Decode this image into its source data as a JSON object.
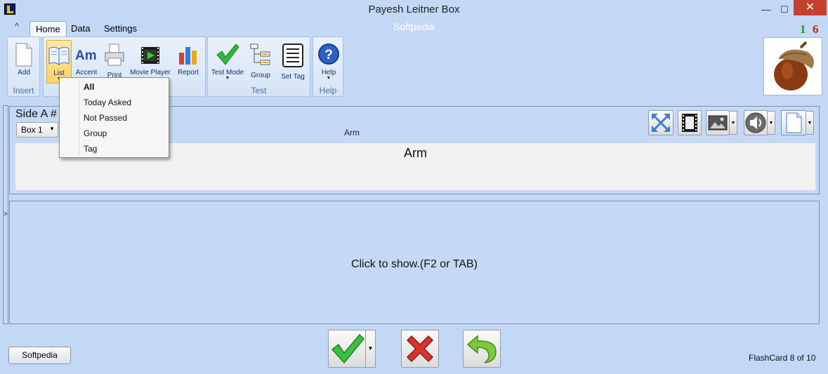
{
  "window": {
    "title": "Payesh Leitner Box",
    "min": "—",
    "max": "☐",
    "close": "✕"
  },
  "tabs": [
    {
      "label": "Home",
      "active": true
    },
    {
      "label": "Data"
    },
    {
      "label": "Settings"
    }
  ],
  "collapse_symbol": "^",
  "watermark": "Softpedia",
  "counters": {
    "green": "1",
    "red": "6",
    "green_color": "#1aa11a",
    "red_color": "#d21e1e"
  },
  "ribbon": {
    "insert": {
      "label": "Insert",
      "add": "Add"
    },
    "view": {
      "list": "List",
      "accent": "Accent",
      "print": "Print",
      "movie": "Movie Player",
      "report": "Report"
    },
    "test": {
      "label": "Test",
      "test_mode": "Test Mode",
      "group": "Group",
      "set_tag": "Set Tag"
    },
    "help": {
      "label": "Help",
      "help": "Help"
    }
  },
  "list_menu": {
    "items": [
      {
        "label": "All",
        "bold": true
      },
      {
        "label": "Today Asked"
      },
      {
        "label": "Not Passed"
      },
      {
        "label": "Group"
      },
      {
        "label": "Tag"
      }
    ]
  },
  "side_a": {
    "title": "Side A #",
    "box_select": "Box 1",
    "small_word": "Arm",
    "word": "Arm"
  },
  "side_b": {
    "hint": "Click to show.(F2 or TAB)",
    "expander": ">"
  },
  "bottom": {
    "softpedia_button": "Softpedia",
    "status": "FlashCard 8 of 10"
  }
}
